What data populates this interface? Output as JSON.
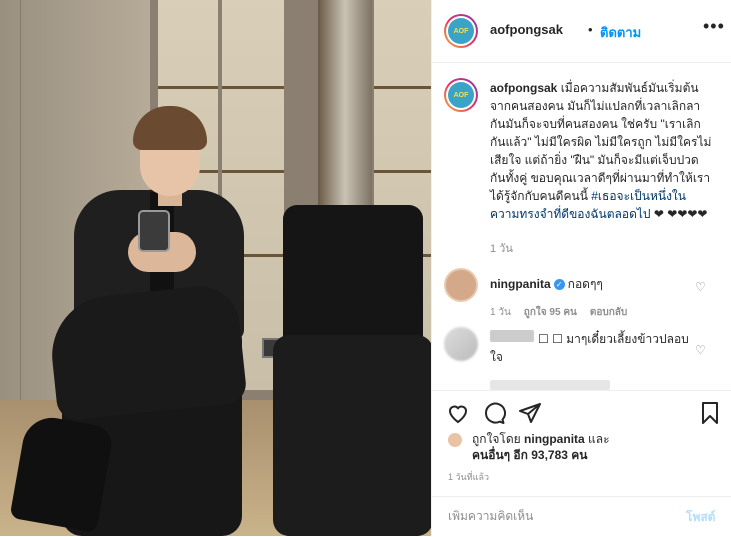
{
  "header": {
    "username": "aofpongsak",
    "separator": "•",
    "follow_label": "ติดตาม",
    "more_icon": "more-horizontal-icon"
  },
  "caption": {
    "username": "aofpongsak",
    "text": "เมื่อความสัมพันธ์มันเริ่มต้นจากคนสองคน มันก็ไม่แปลกที่เวลาเลิกลากันมันก็จะจบที่คนสองคน ใช่ครับ \"เราเลิกกันแล้ว\" ไม่มีใครผิด ไม่มีใครถูก ไม่มีใครไม่เสียใจ แต่ถ้ายิ่ง \"ฝืน\" มันก็จะมีแต่เจ็บปวดกันทั้งคู่ ขอบคุณเวลาดีๆที่ผ่านมาที่ทำให้เราได้รู้จักกับคนดีคนนี้ ",
    "hashtag": "#เธอจะเป็นหนึ่งในความทรงจำที่ดีของฉันตลอดไป",
    "hearts": " ❤ ❤❤❤❤",
    "time": "1 วัน"
  },
  "comments": [
    {
      "username": "ningpanita",
      "verified_icon": "verified-badge-icon",
      "text": "กอดๆๆ",
      "time": "1 วัน",
      "likes": "ถูกใจ 95 คน",
      "reply_label": "ตอบกลับ"
    },
    {
      "text": "⁣☐ ☐ มาๆเดี๋ยวเลี้ยงข้าวปลอบใจ"
    }
  ],
  "actions": {
    "liked_prefix": "ถูกใจโดย ",
    "liked_user": "ningpanita",
    "liked_and": " และ",
    "others_label": "คนอื่นๆ อีก 93,783 คน",
    "post_time": "1 วันที่แล้ว"
  },
  "add_comment": {
    "placeholder": "เพิ่มความคิดเห็น",
    "post_label": "โพสต์"
  },
  "colors": {
    "accent": "#0095f6",
    "hashtag": "#00376b",
    "muted": "#8e8e8e",
    "post_disabled": "#b2dffc"
  }
}
